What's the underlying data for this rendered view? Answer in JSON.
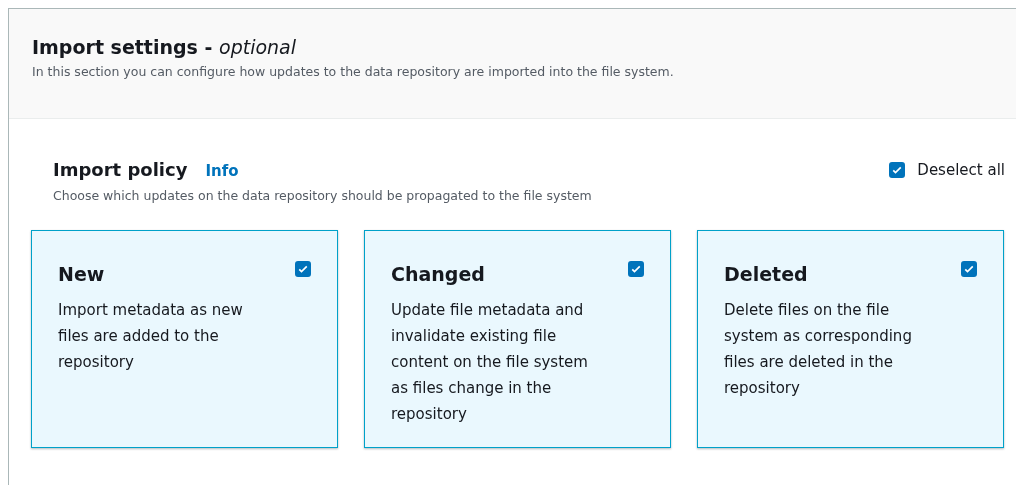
{
  "header": {
    "title": "Import settings - ",
    "title_suffix": "optional",
    "description": "In this section you can configure how updates to the data repository are imported into the file system."
  },
  "policy": {
    "title": "Import policy",
    "info_link": "Info",
    "description": "Choose which updates on the data repository should be propagated to the file system",
    "deselect_all": {
      "label": "Deselect all",
      "checked": true
    }
  },
  "options": [
    {
      "title": "New",
      "description": "Import metadata as new files are added to the repository",
      "checked": true
    },
    {
      "title": "Changed",
      "description": "Update file metadata and invalidate existing file content on the file system as files change in the repository",
      "checked": true
    },
    {
      "title": "Deleted",
      "description": "Delete files on the file system as corresponding files are deleted in the repository",
      "checked": true
    }
  ]
}
